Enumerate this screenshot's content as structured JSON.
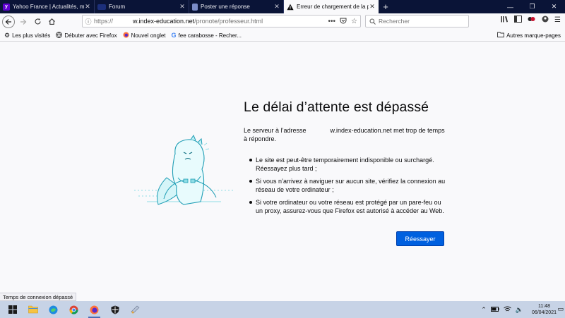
{
  "tabs": [
    {
      "title": "Yahoo France | Actualités, mail et recherche",
      "favicon": "yahoo-icon",
      "active": false
    },
    {
      "title": "Forum",
      "favicon": "forum-icon",
      "active": false
    },
    {
      "title": "Poster une réponse",
      "favicon": "forum-icon",
      "active": false
    },
    {
      "title": "Erreur de chargement de la page",
      "favicon": "warning-icon",
      "active": true
    }
  ],
  "url": {
    "prefix": "https://",
    "host": "w.index-education.net",
    "path": "/pronote/professeur.html"
  },
  "search": {
    "placeholder": "Rechercher"
  },
  "bookmarks": [
    {
      "label": "Les plus visités",
      "icon": "gear-icon"
    },
    {
      "label": "Débuter avec Firefox",
      "icon": "globe-icon"
    },
    {
      "label": "Nouvel onglet",
      "icon": "firefox-icon"
    },
    {
      "label": "fee carabosse - Recher...",
      "icon": "google-icon"
    }
  ],
  "other_bookmarks": "Autres marque-pages",
  "error": {
    "title": "Le délai d’attente est dépassé",
    "desc_before": "Le serveur à l’adresse",
    "desc_host": "w.index-education.net",
    "desc_after": "met trop de temps à répondre.",
    "bullets": [
      "Le site est peut-être temporairement indisponible ou surchargé. Réessayez plus tard ;",
      "Si vous n’arrivez à naviguer sur aucun site, vérifiez la connexion au réseau de votre ordinateur ;",
      "Si votre ordinateur ou votre réseau est protégé par un pare-feu ou un proxy, assurez-vous que Firefox est autorisé à accéder au Web."
    ],
    "retry_label": "Réessayer"
  },
  "status_text": "Temps de connexion dépassé",
  "clock": {
    "time": "11:48",
    "date": "06/04/2021"
  },
  "colors": {
    "accent": "#0060df",
    "tabstrip": "#0a1437",
    "taskbar": "#c7d3e6"
  }
}
